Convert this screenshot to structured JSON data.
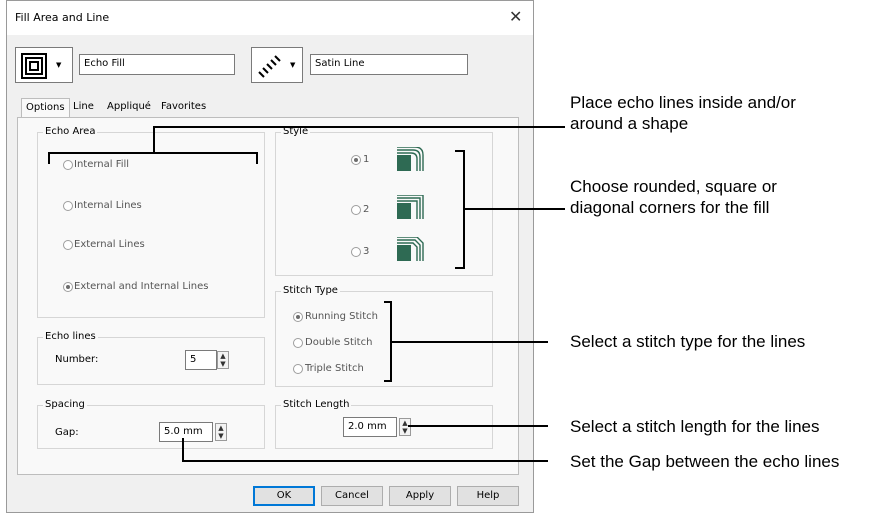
{
  "dialog": {
    "title": "Fill Area and Line",
    "fill_name": "Echo Fill",
    "line_name": "Satin Line"
  },
  "tabs": [
    "Options",
    "Line",
    "Appliqué",
    "Favorites"
  ],
  "echo_area": {
    "label": "Echo Area",
    "options": [
      "Internal Fill",
      "Internal Lines",
      "External Lines",
      "External and Internal Lines"
    ],
    "selected": "External and Internal Lines"
  },
  "style": {
    "label": "Style",
    "options": [
      "1",
      "2",
      "3"
    ],
    "selected": "1"
  },
  "echo_lines": {
    "label": "Echo lines",
    "number_label": "Number:",
    "number_value": "5"
  },
  "stitch_type": {
    "label": "Stitch Type",
    "options": [
      "Running Stitch",
      "Double Stitch",
      "Triple Stitch"
    ],
    "selected": "Running Stitch"
  },
  "spacing": {
    "label": "Spacing",
    "gap_label": "Gap:",
    "gap_value": "5.0 mm"
  },
  "stitch_length": {
    "label": "Stitch Length",
    "value": "2.0 mm"
  },
  "buttons": {
    "ok": "OK",
    "cancel": "Cancel",
    "apply": "Apply",
    "help": "Help"
  },
  "callouts": {
    "echo_area_1": "Place echo lines inside and/or",
    "echo_area_2": "around a shape",
    "style_1": "Choose rounded, square or",
    "style_2": "diagonal corners for the fill",
    "stitch_type": "Select a stitch type for the lines",
    "stitch_length": "Select a stitch length for the lines",
    "gap": "Set the Gap between the echo lines"
  },
  "colors": {
    "dialog_bg": "#f0f0f0",
    "tab_bg": "#f9f9f9",
    "style_swatch": "#2e6a53",
    "default_button_border": "#0078d7"
  },
  "icons": {
    "close": "close-icon",
    "fill_type": "echo-fill-icon",
    "line_type": "satin-line-icon"
  }
}
